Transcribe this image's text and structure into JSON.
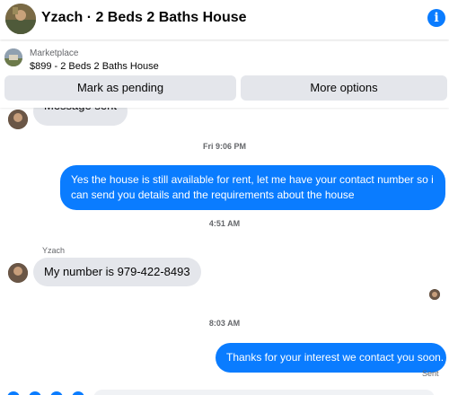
{
  "header": {
    "title": "Yzach · 2 Beds 2 Baths House",
    "info_icon": "i"
  },
  "listing": {
    "category": "Marketplace",
    "item": "$899 - 2 Beds 2 Baths House",
    "buttons": {
      "pending": "Mark as pending",
      "more": "More options"
    }
  },
  "messages": {
    "m0": "Message sent",
    "t1": "Fri 9:06 PM",
    "m1": "Yes the house is still available for rent, let me have your contact number so i can send you details and the requirements about the house",
    "t2": "4:51 AM",
    "sender": "Yzach",
    "m2": "My number is 979-422-8493",
    "t3": "8:03 AM",
    "m3": "Thanks for your interest we contact you soon.",
    "sent": "Sent"
  },
  "colors": {
    "accent": "#0a7cff",
    "incoming_bg": "#e4e6eb"
  }
}
